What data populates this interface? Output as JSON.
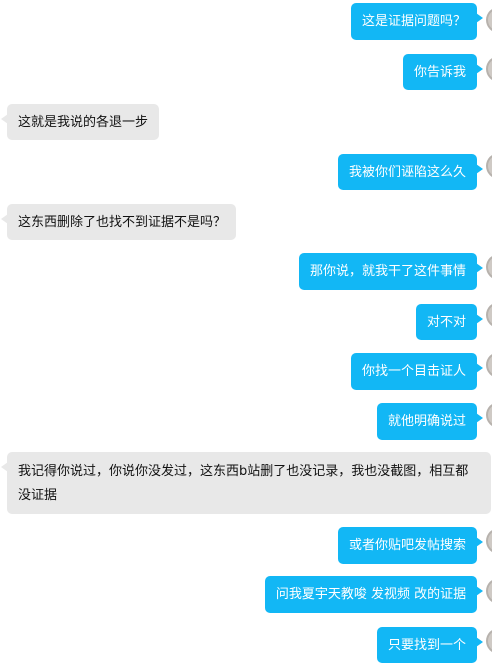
{
  "messages": [
    {
      "side": "out",
      "text": "这是证据问题吗？"
    },
    {
      "side": "out",
      "text": "你告诉我"
    },
    {
      "side": "in",
      "text": "这就是我说的各退一步"
    },
    {
      "side": "out",
      "text": "我被你们诬陷这么久"
    },
    {
      "side": "in",
      "text": "这东西删除了也找不到证据不是吗？"
    },
    {
      "side": "out",
      "text": "那你说，就我干了这件事情"
    },
    {
      "side": "out",
      "text": "对不对"
    },
    {
      "side": "out",
      "text": "你找一个目击证人"
    },
    {
      "side": "out",
      "text": "就他明确说过"
    },
    {
      "side": "in",
      "text": "我记得你说过，你说你没发过，这东西b站删了也没记录，我也没截图，相互都没证据"
    },
    {
      "side": "out",
      "text": "或者你贴吧发帖搜索"
    },
    {
      "side": "out",
      "text": "问我夏宇天教唆 发视频 改的证据"
    },
    {
      "side": "out",
      "text": "只要找到一个"
    }
  ]
}
